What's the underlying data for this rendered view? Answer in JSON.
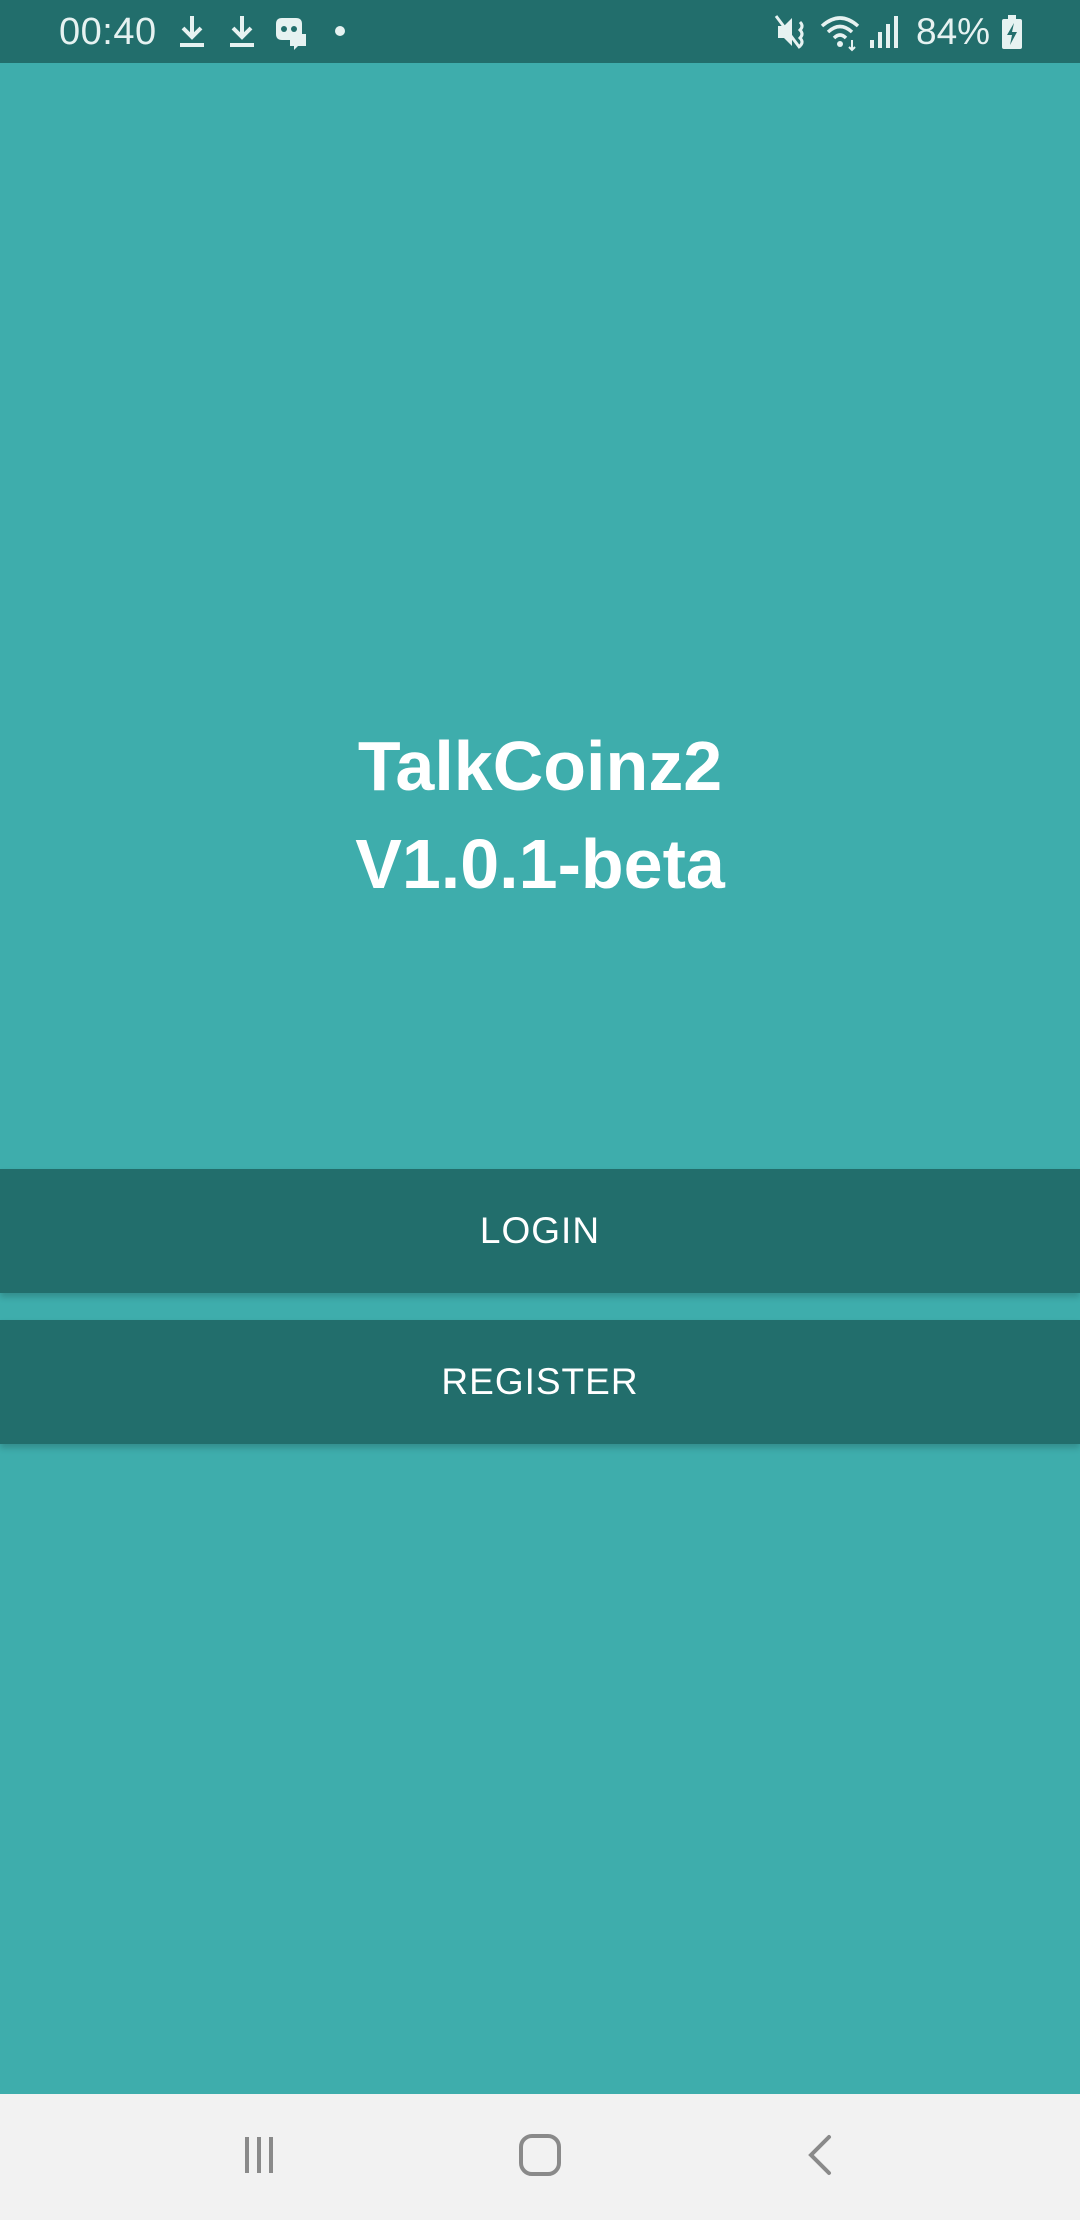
{
  "status_bar": {
    "time": "00:40",
    "battery_percent": "84%",
    "left_icons": [
      "download-icon",
      "download-icon",
      "game-controller-icon",
      "notification-dot-icon"
    ],
    "right_icons": [
      "mute-vibrate-icon",
      "wifi-icon",
      "signal-icon",
      "battery-charging-icon"
    ]
  },
  "app": {
    "title_line1": "TalkCoinz2",
    "title_line2": "V1.0.1-beta"
  },
  "buttons": {
    "login_label": "LOGIN",
    "register_label": "REGISTER"
  },
  "nav_bar": {
    "buttons": [
      "recent-apps-icon",
      "home-icon",
      "back-icon"
    ]
  },
  "colors": {
    "background": "#3eadac",
    "primary_dark": "#226e6c",
    "text": "#ffffff",
    "nav_bar": "#f2f2f2"
  }
}
